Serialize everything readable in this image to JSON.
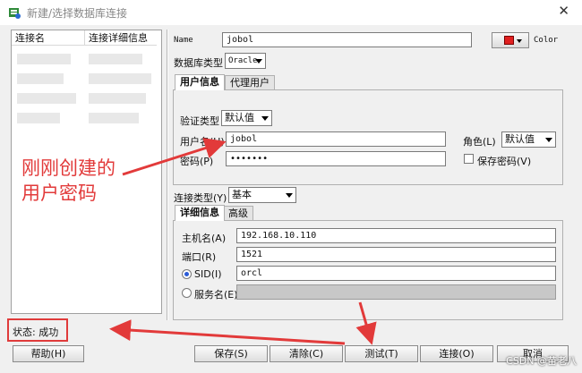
{
  "window": {
    "title": "新建/选择数据库连接",
    "close": "✕"
  },
  "connections": {
    "col_name": "连接名",
    "col_detail": "连接详细信息"
  },
  "form": {
    "name_label": "Name",
    "name_value": "jobol",
    "color_label": "Color",
    "color_swatch": "#e02020",
    "dbtype_label": "数据库类型",
    "dbtype_value": "Oracle",
    "auth_tabs": [
      {
        "label": "用户信息"
      },
      {
        "label": "代理用户"
      }
    ],
    "auth_type_label": "验证类型",
    "auth_type_value": "默认值",
    "username_label": "用户名(U)",
    "username_value": "jobol",
    "password_label": "密码(P)",
    "password_value": "•••••••",
    "role_label": "角色(L)",
    "role_value": "默认值",
    "save_password_label": "保存密码(V)",
    "conn_type_label": "连接类型(Y)",
    "conn_type_value": "基本",
    "detail_tabs": [
      {
        "label": "详细信息"
      },
      {
        "label": "高级"
      }
    ],
    "host_label": "主机名(A)",
    "host_value": "192.168.10.110",
    "port_label": "端口(R)",
    "port_value": "1521",
    "sid_label": "SID(I)",
    "sid_value": "orcl",
    "service_label": "服务名(E)",
    "service_value": ""
  },
  "status": {
    "text": "状态: 成功"
  },
  "buttons": {
    "help": "帮助(H)",
    "save": "保存(S)",
    "clear": "清除(C)",
    "test": "测试(T)",
    "connect": "连接(O)",
    "cancel": "取消"
  },
  "annotation": {
    "line1": "刚刚创建的",
    "line2": "用户密码"
  },
  "watermark": "CSDN @苗老八",
  "colors": {
    "annotation": "#e23a3a"
  }
}
